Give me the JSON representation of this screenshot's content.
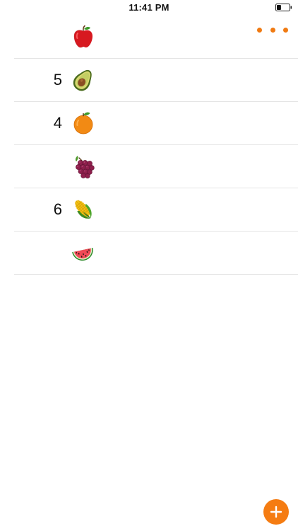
{
  "status_bar": {
    "time": "11:41 PM",
    "battery_level": 0.35
  },
  "header": {
    "more_icon": "more-horizontal-icon",
    "accent_color": "#f07a12"
  },
  "items": [
    {
      "count": "",
      "emoji": "apple"
    },
    {
      "count": "5",
      "emoji": "avocado"
    },
    {
      "count": "4",
      "emoji": "orange"
    },
    {
      "count": "",
      "emoji": "grapes"
    },
    {
      "count": "6",
      "emoji": "corn"
    },
    {
      "count": "",
      "emoji": "watermelon"
    }
  ],
  "fab": {
    "icon": "plus-icon",
    "color": "#f57c12"
  }
}
